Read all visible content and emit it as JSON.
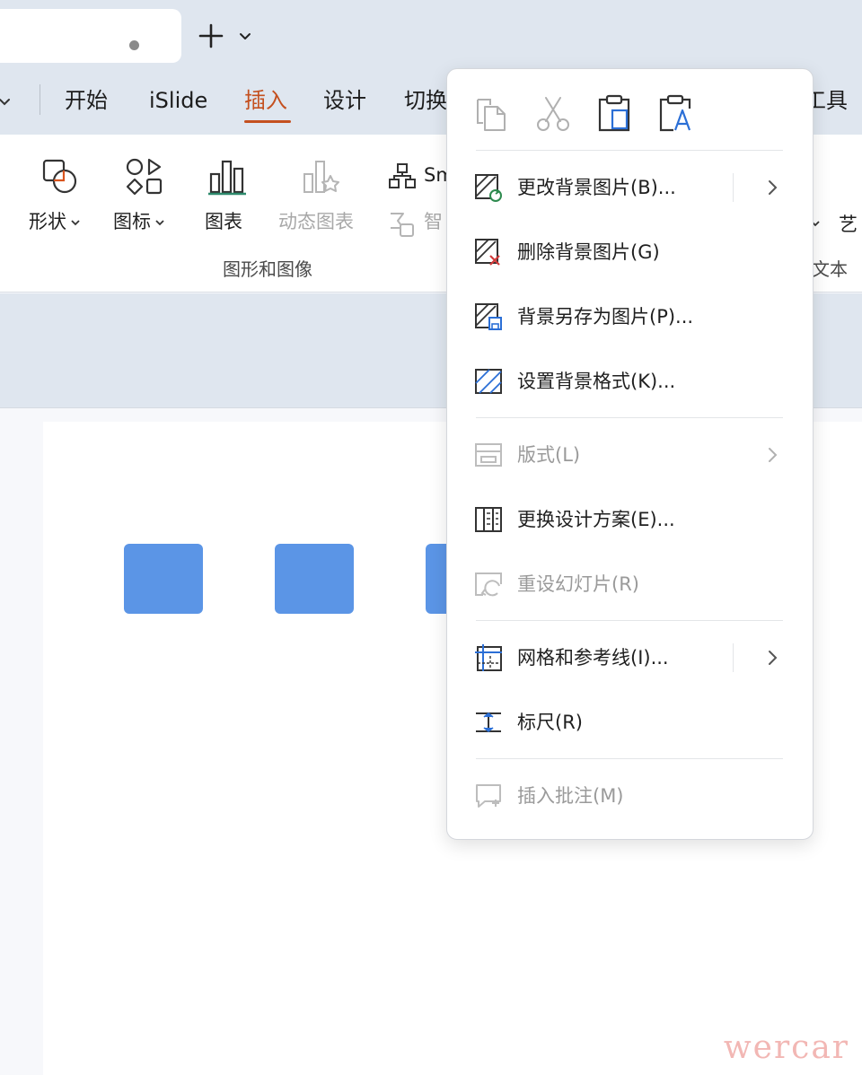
{
  "menu_tabs": [
    {
      "label": "开始"
    },
    {
      "label": "iSlide"
    },
    {
      "label": "插入"
    },
    {
      "label": "设计"
    },
    {
      "label": "切换"
    },
    {
      "label": "工具"
    }
  ],
  "ribbon": {
    "buttons": [
      {
        "label": "形状"
      },
      {
        "label": "图标"
      },
      {
        "label": "图表"
      },
      {
        "label": "动态图表"
      },
      {
        "label": "Sm"
      },
      {
        "label": "智"
      }
    ],
    "group_label": "图形和图像",
    "right_edge_label": "艺",
    "right_group_label": "文本"
  },
  "context_menu": {
    "items": [
      {
        "label": "更改背景图片(B)..."
      },
      {
        "label": "删除背景图片(G)"
      },
      {
        "label": "背景另存为图片(P)..."
      },
      {
        "label": "设置背景格式(K)..."
      },
      {
        "label": "版式(L)"
      },
      {
        "label": "更换设计方案(E)..."
      },
      {
        "label": "重设幻灯片(R)"
      },
      {
        "label": "网格和参考线(I)..."
      },
      {
        "label": "标尺(R)"
      },
      {
        "label": "插入批注(M)"
      }
    ]
  },
  "watermark": "wercar",
  "colors": {
    "accent": "#c4501f",
    "shape_fill": "#5b95e6",
    "chrome": "#dfe6ef"
  }
}
